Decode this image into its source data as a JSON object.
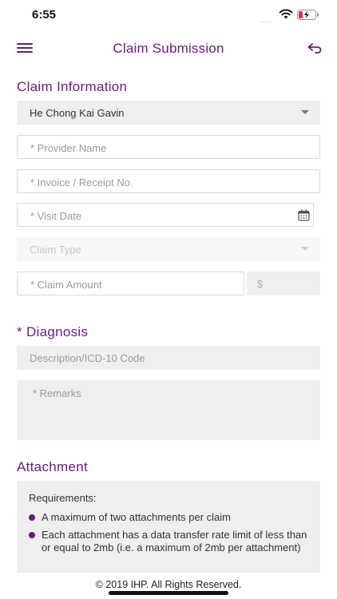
{
  "status_bar": {
    "time": "6:55",
    "signal": "....",
    "battery_fill_fraction": 0.25,
    "battery_color": "#e5352f"
  },
  "header": {
    "title": "Claim Submission"
  },
  "claim_information": {
    "title": "Claim Information",
    "member_value": "He Chong Kai Gavin",
    "provider_placeholder": "* Provider Name",
    "invoice_placeholder": "* Invoice / Receipt No.",
    "visit_date_placeholder": "* Visit Date",
    "claim_type_placeholder": "Claim Type",
    "claim_amount_placeholder": "* Claim Amount",
    "currency_symbol": "$"
  },
  "diagnosis": {
    "title": "* Diagnosis",
    "code_placeholder": "Description/ICD-10 Code",
    "remarks_placeholder": "* Remarks"
  },
  "attachment": {
    "title": "Attachment",
    "requirements_heading": "Requirements:",
    "requirements": [
      "A maximum of two attachments per claim",
      "Each attachment has a data transfer rate limit of less than or equal to 2mb (i.e. a maximum of 2mb per attachment)"
    ]
  },
  "footer": {
    "copyright": "© 2019 IHP. All Rights Reserved."
  },
  "colors": {
    "accent": "#6d1a7e",
    "field_fill": "#efefef",
    "field_border": "#d9d9d9"
  }
}
